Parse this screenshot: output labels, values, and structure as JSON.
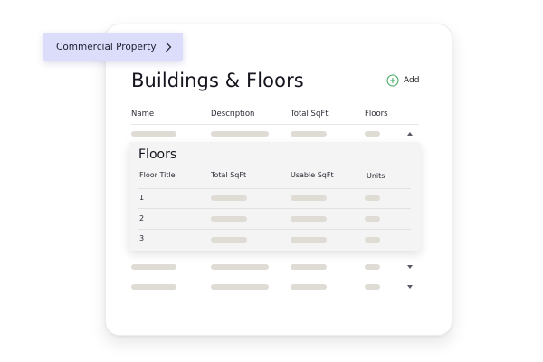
{
  "breadcrumb": {
    "label": "Commercial Property"
  },
  "page": {
    "title": "Buildings & Floors"
  },
  "toolbar": {
    "add_label": "Add"
  },
  "table": {
    "columns": [
      "Name",
      "Description",
      "Total SqFt",
      "Floors"
    ]
  },
  "floors": {
    "title": "Floors",
    "columns": [
      "Floor Title",
      "Total SqFt",
      "Usable SqFt",
      "Units"
    ],
    "rows": [
      "1",
      "2",
      "3"
    ]
  },
  "colors": {
    "breadcrumb_bg": "#dcdcfb",
    "accent_green": "#3aa55a",
    "placeholder": "#dfdcd6"
  },
  "icons": {
    "breadcrumb_chevron": "chevron-right-icon",
    "add": "plus-circle-icon",
    "expanded": "caret-up-icon",
    "collapsed": "caret-down-icon"
  }
}
